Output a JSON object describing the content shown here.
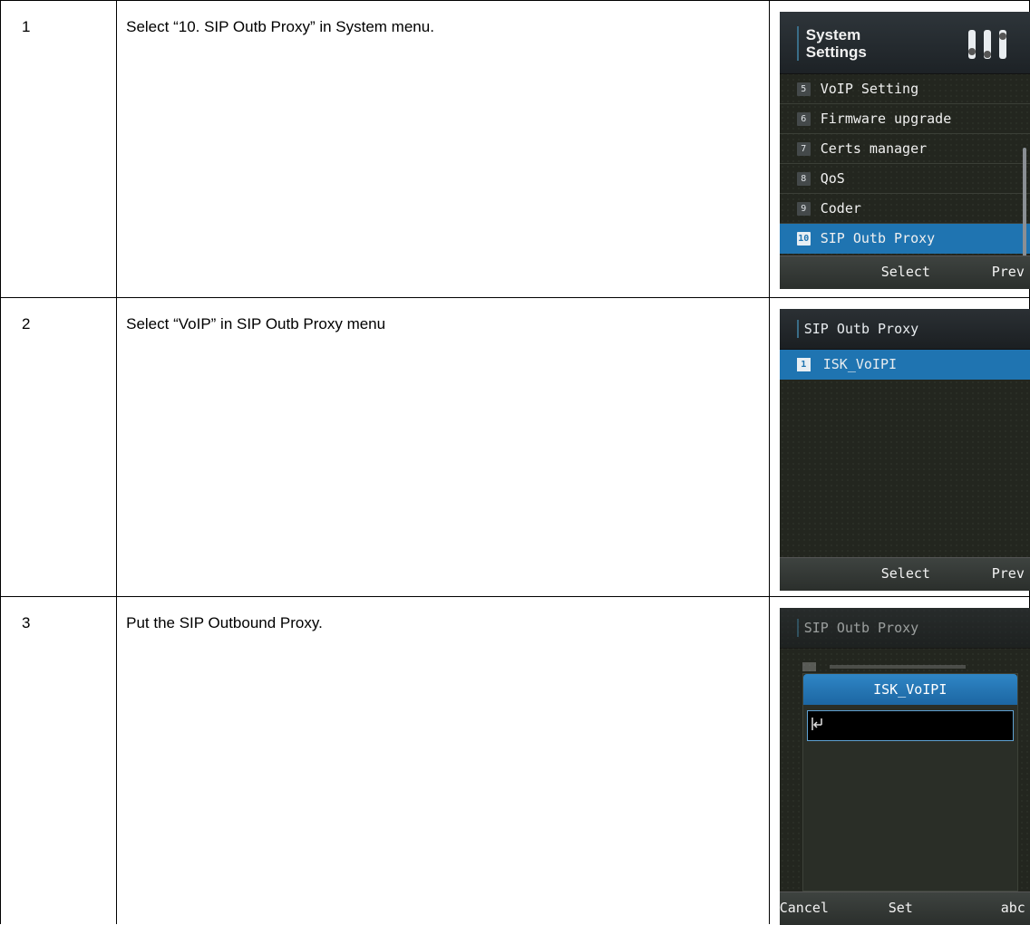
{
  "steps": [
    {
      "number": "1",
      "text": "Select “10. SIP Outb Proxy” in System menu."
    },
    {
      "number": "2",
      "text": "Select “VoIP” in SIP Outb Proxy menu"
    },
    {
      "number": "3",
      "text": "Put the SIP Outbound Proxy."
    }
  ],
  "screen1": {
    "title_line1": "System",
    "title_line2": "Settings",
    "icon": "sliders-icon",
    "items": [
      {
        "idx": "5",
        "label": "VoIP Setting"
      },
      {
        "idx": "6",
        "label": "Firmware upgrade"
      },
      {
        "idx": "7",
        "label": "Certs manager"
      },
      {
        "idx": "8",
        "label": "QoS"
      },
      {
        "idx": "9",
        "label": "Coder"
      },
      {
        "idx": "10",
        "label": "SIP Outb Proxy"
      }
    ],
    "selected_index": 5,
    "softkey_center": "Select",
    "softkey_right": "Prev"
  },
  "screen2": {
    "header": "SIP Outb Proxy",
    "item_idx": "1",
    "item_label": "ISK_VoIPI",
    "softkey_center": "Select",
    "softkey_right": "Prev"
  },
  "screen3": {
    "header": "SIP Outb Proxy",
    "dialog_title": "ISK_VoIPI",
    "input_value": "",
    "icon": "enter-cursor-icon",
    "softkey_left": "Cancel",
    "softkey_center": "Set",
    "softkey_right": "abc"
  },
  "colors": {
    "highlight": "#1f74b1",
    "screen_bg": "#23261f"
  }
}
